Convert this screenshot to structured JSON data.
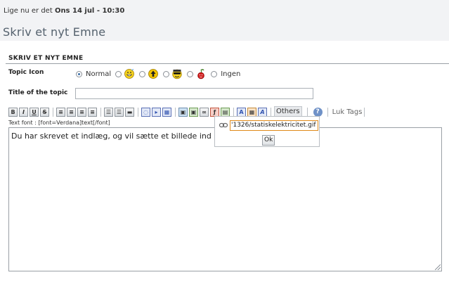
{
  "header": {
    "date_prefix": "Lige nu er det",
    "date_value": "Ons 14 jul - 10:30",
    "page_title": "Skriv et nyt Emne"
  },
  "form": {
    "section_title": "SKRIV ET NYT EMNE",
    "topic_icon_label": "Topic Icon",
    "topic_icon_options": [
      {
        "label": "Normal",
        "icon": "none",
        "selected": true
      },
      {
        "label": "",
        "icon": "grin-smiley-icon",
        "selected": false
      },
      {
        "label": "",
        "icon": "up-arrow-icon",
        "selected": false
      },
      {
        "label": "",
        "icon": "sunglasses-smiley-icon",
        "selected": false
      },
      {
        "label": "",
        "icon": "cherry-icon",
        "selected": false
      },
      {
        "label": "Ingen",
        "icon": "none",
        "selected": false
      }
    ],
    "title_label": "Title of the topic",
    "title_value": "",
    "toolbar": {
      "bold": "B",
      "italic": "I",
      "underline": "U",
      "strike": "S",
      "others": "Others",
      "help": "?",
      "close_tags": "Luk Tags"
    },
    "font_hint": "Text font : [font=Verdana]text[/font]",
    "message_text": "Du har skrevet et indlæg, og vil sætte et billede ind"
  },
  "link_popup": {
    "url_value": "'1326/statiskelektricitet.gif",
    "ok_label": "Ok"
  },
  "colors": {
    "page_bg": "#f2f3f5",
    "title_color": "#55626e",
    "popup_focus_border": "#e08a1a"
  }
}
